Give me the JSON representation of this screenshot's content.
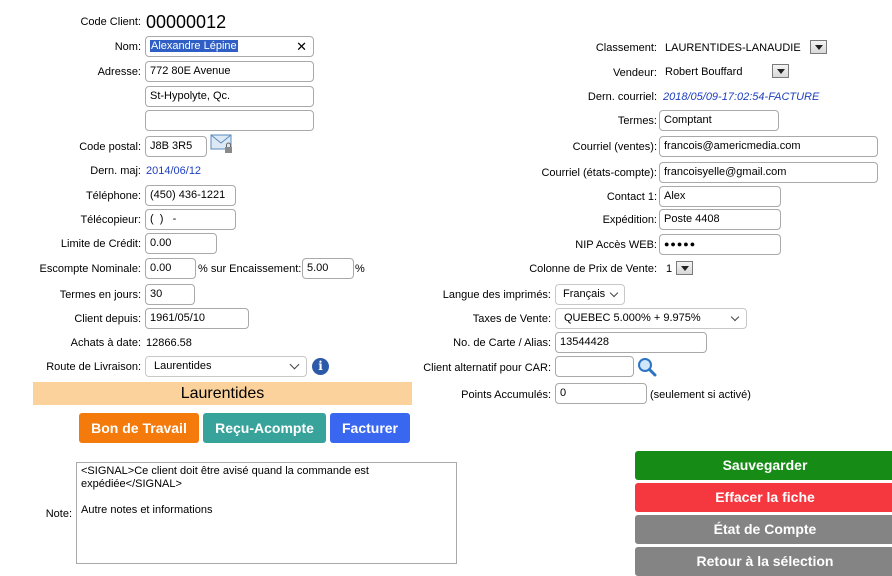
{
  "client": {
    "code_label": "Code Client:",
    "code_value": "00000012",
    "name_label": "Nom:",
    "name_value": "Alexandre Lépine",
    "address_label": "Adresse:",
    "address_line1": "772  80E Avenue",
    "address_line2": "St-Hypolyte, Qc.",
    "address_line3": "",
    "postal_label": "Code postal:",
    "postal_value": "J8B 3R5",
    "last_update_label": "Dern. maj:",
    "last_update_value": "2014/06/12",
    "phone_label": "Téléphone:",
    "phone_value": "(450) 436-1221",
    "fax_label": "Télécopieur:",
    "fax_value": "(  )   -",
    "credit_limit_label": "Limite de Crédit:",
    "credit_limit_value": "0.00",
    "discount_label": "Escompte Nominale:",
    "discount_value": "0.00",
    "discount_pct_label": "% sur Encaissement:",
    "discount_pct_value": "5.00",
    "pct_sign": "%",
    "terms_days_label": "Termes en jours:",
    "terms_days_value": "30",
    "client_since_label": "Client depuis:",
    "client_since_value": "1961/05/10",
    "purchases_label": "Achats à date:",
    "purchases_value": "12866.58",
    "route_label": "Route de Livraison:",
    "route_value": "Laurentides",
    "route_banner": "Laurentides"
  },
  "right": {
    "classement_label": "Classement:",
    "classement_value": "LAURENTIDES-LANAUDIE",
    "vendeur_label": "Vendeur:",
    "vendeur_value": "Robert Bouffard",
    "dern_courriel_label": "Dern. courriel:",
    "dern_courriel_value": "2018/05/09-17:02:54-FACTURE",
    "termes_label": "Termes:",
    "termes_value": "Comptant",
    "courriel_ventes_label": "Courriel (ventes):",
    "courriel_ventes_value": "francois@americmedia.com",
    "courriel_etats_label": "Courriel (états-compte):",
    "courriel_etats_value": "francoisyelle@gmail.com",
    "contact_label": "Contact 1:",
    "contact_value": "Alex",
    "expedition_label": "Expédition:",
    "expedition_value": "Poste 4408",
    "nip_label": "NIP Accès WEB:",
    "nip_value": "●●●●●",
    "colonne_label": "Colonne de Prix de Vente:",
    "colonne_value": "1",
    "langue_label": "Langue des imprimés:",
    "langue_value": "Français",
    "taxes_label": "Taxes de Vente:",
    "taxes_value": "QUEBEC 5.000% + 9.975%",
    "carte_label": "No. de Carte / Alias:",
    "carte_value": "13544428",
    "car_label": "Client alternatif pour CAR:",
    "car_value": "",
    "points_label": "Points Accumulés:",
    "points_value": "0",
    "points_note": "(seulement si activé)"
  },
  "actions": {
    "bon_travail": "Bon de Travail",
    "recu_acompte": "Reçu-Acompte",
    "facturer": "Facturer",
    "sauvegarder": "Sauvegarder",
    "effacer": "Effacer la fiche",
    "etat_compte": "État de Compte",
    "retour": "Retour à la sélection"
  },
  "note": {
    "label": "Note:",
    "text": "<SIGNAL>Ce client doit être avisé quand la commande est expédiée</SIGNAL>\n\nAutre notes et informations"
  },
  "icons": {
    "mail": "mail-lock-icon",
    "info": "info-icon",
    "search": "search-icon",
    "clear": "clear-icon"
  },
  "colors": {
    "banner": "#fcd29c",
    "orange": "#f47a0c",
    "teal": "#38a39b",
    "blue": "#3a67f0",
    "green": "#168c16",
    "red": "#f5383f",
    "gray": "#848484"
  }
}
